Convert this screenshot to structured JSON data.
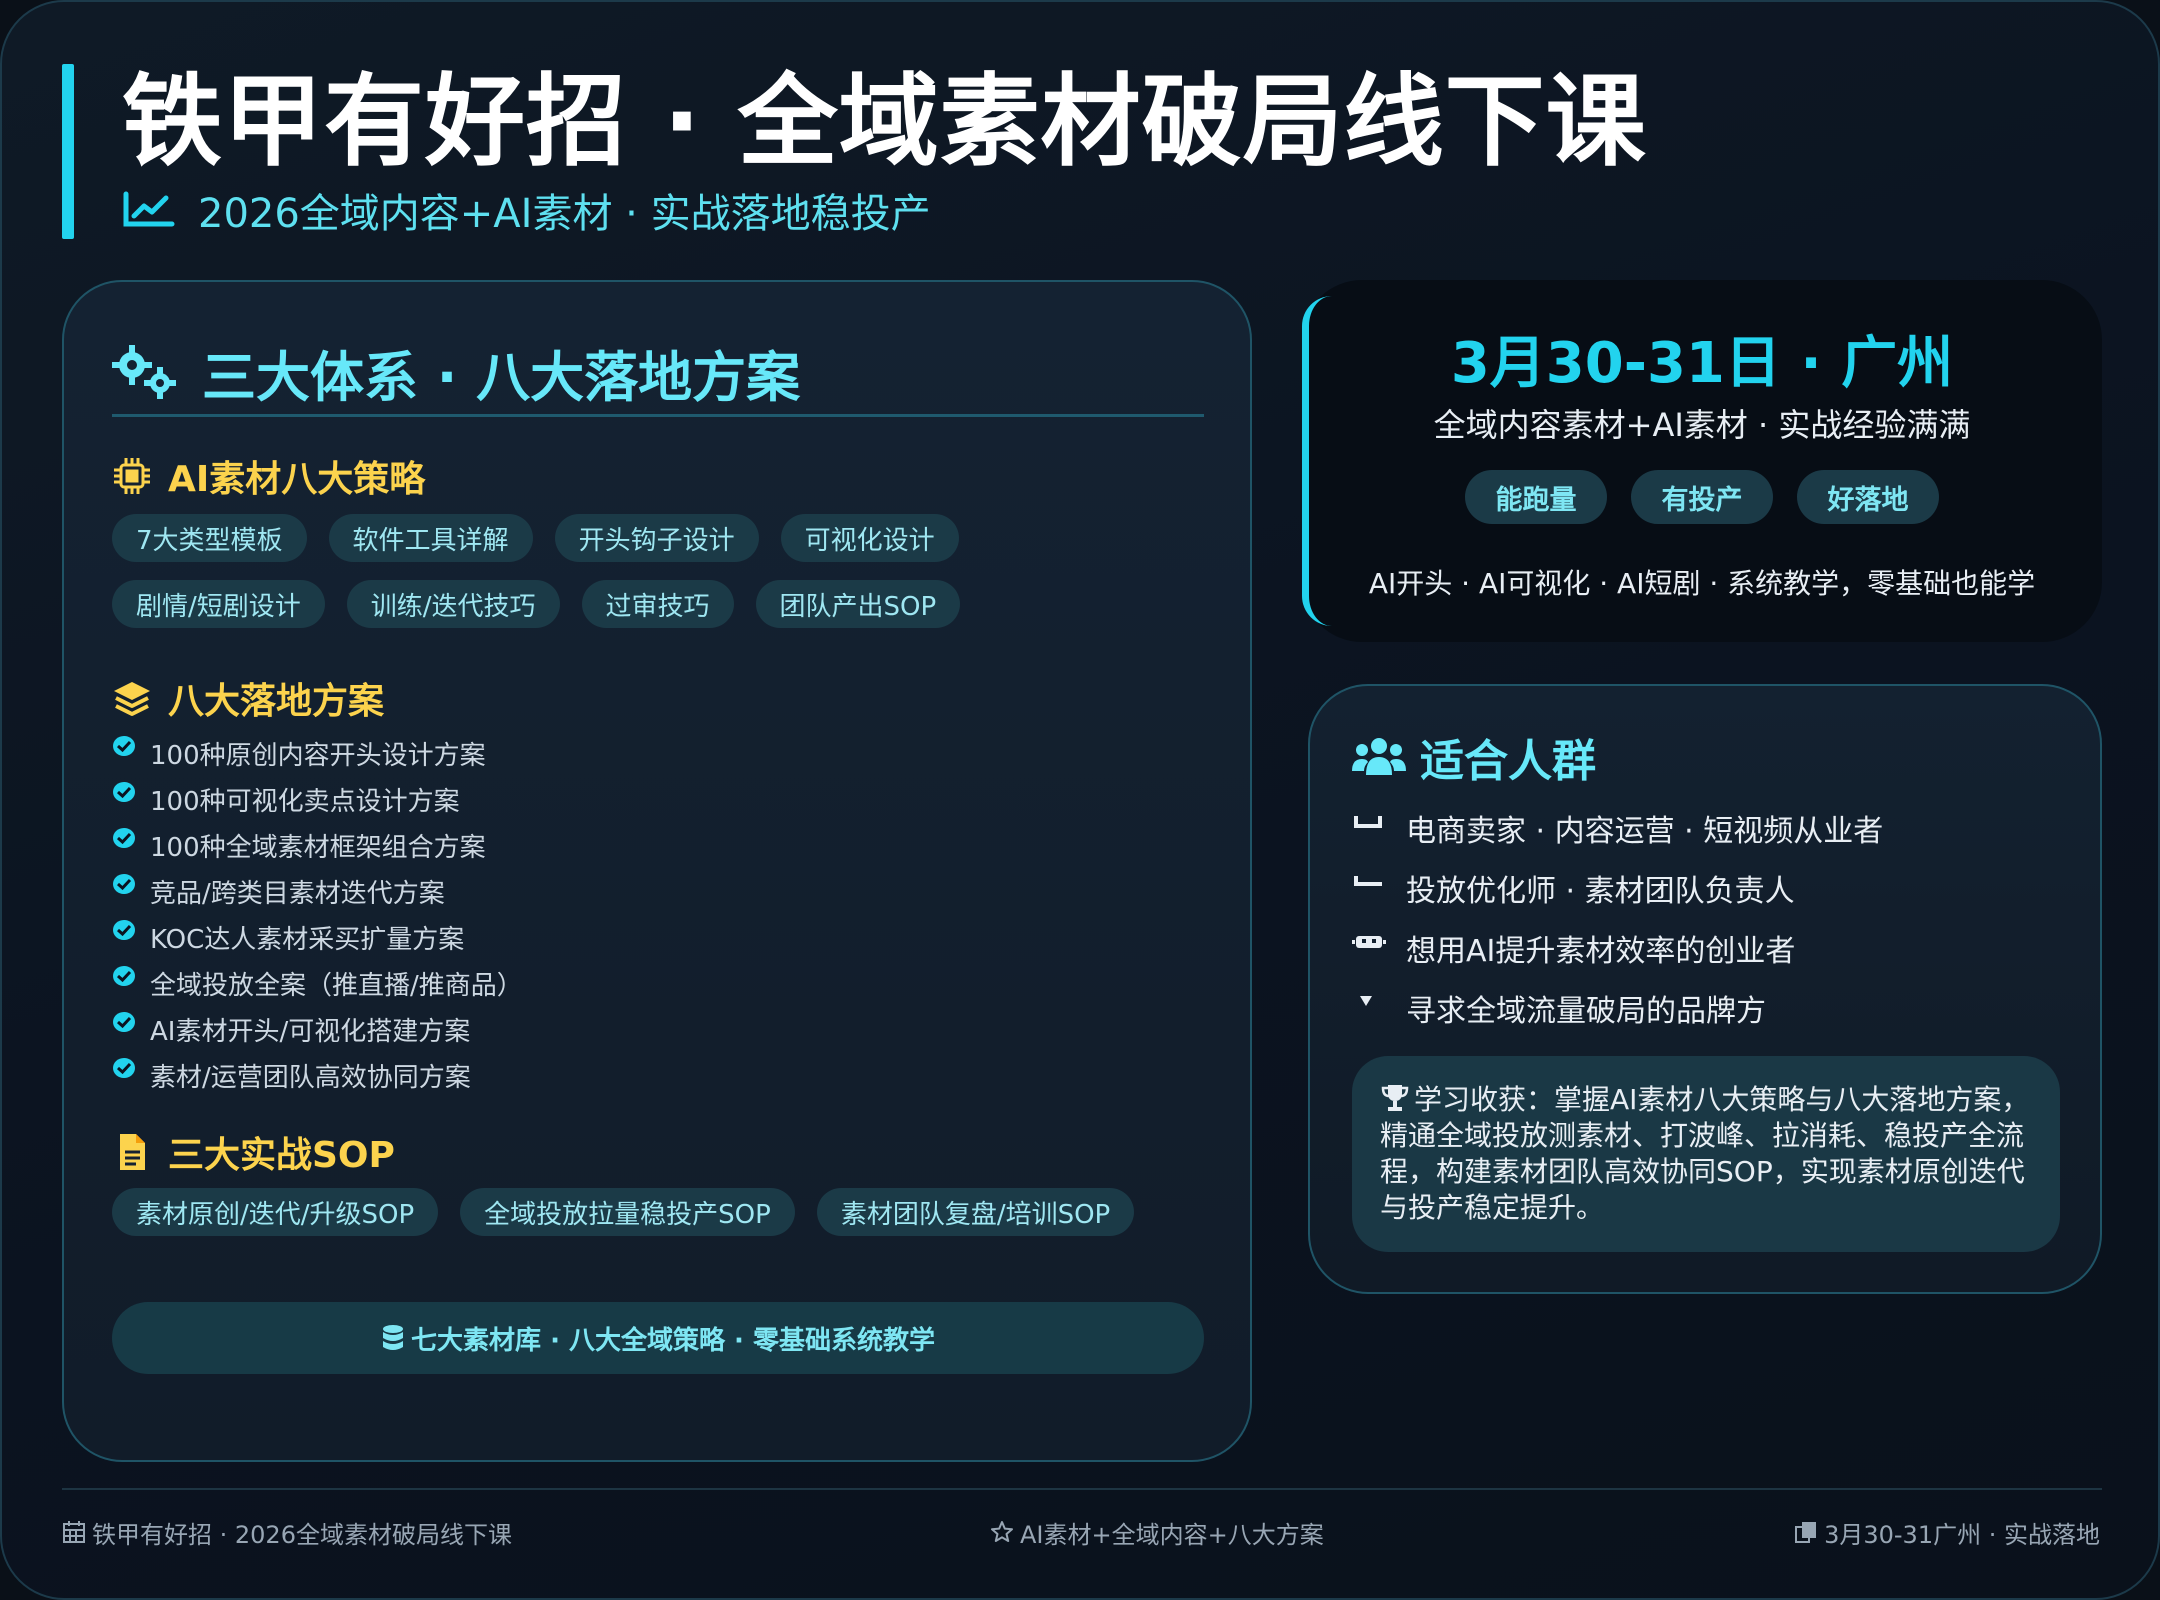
{
  "header": {
    "title": "铁甲有好招 · 全域素材破局线下课",
    "subtitle": "2026全域内容+AI素材 · 实战落地稳投产"
  },
  "left_panel": {
    "title": "三大体系 · 八大落地方案",
    "strategies": {
      "title": "AI素材八大策略",
      "chips": [
        "7大类型模板",
        "软件工具详解",
        "开头钩子设计",
        "可视化设计",
        "剧情/短剧设计",
        "训练/迭代技巧",
        "过审技巧",
        "团队产出SOP"
      ]
    },
    "plans": {
      "title": "八大落地方案",
      "items": [
        "100种原创内容开头设计方案",
        "100种可视化卖点设计方案",
        "100种全域素材框架组合方案",
        "竞品/跨类目素材迭代方案",
        "KOC达人素材采买扩量方案",
        "全域投放全案（推直播/推商品）",
        "AI素材开头/可视化搭建方案",
        "素材/运营团队高效协同方案"
      ]
    },
    "sops": {
      "title": "三大实战SOP",
      "chips": [
        "素材原创/迭代/升级SOP",
        "全域投放拉量稳投产SOP",
        "素材团队复盘/培训SOP"
      ]
    },
    "banner": "七大素材库 · 八大全域策略 · 零基础系统教学"
  },
  "event": {
    "date": "3月30-31日 · 广州",
    "desc": "全域内容素材+AI素材 · 实战经验满满",
    "badges": [
      "能跑量",
      "有投产",
      "好落地"
    ],
    "foot": "AI开头 · AI可视化 · AI短剧 · 系统教学，零基础也能学"
  },
  "audience": {
    "title": "适合人群",
    "items": [
      {
        "icon": "store-icon",
        "text": "电商卖家 · 内容运营 · 短视频从业者"
      },
      {
        "icon": "chart-line-icon",
        "text": "投放优化师 · 素材团队负责人"
      },
      {
        "icon": "robot-icon",
        "text": "想用AI提升素材效率的创业者"
      },
      {
        "icon": "rocket-icon",
        "text": "寻求全域流量破局的品牌方"
      }
    ],
    "gain": "学习收获：掌握AI素材八大策略与八大落地方案，精通全域投放测素材、打波峰、拉消耗、稳投产全流程，构建素材团队高效协同SOP，实现素材原创迭代与投产稳定提升。"
  },
  "footer": {
    "left": "铁甲有好招 · 2026全域素材破局线下课",
    "center": "AI素材+全域内容+八大方案",
    "right": "3月30-31广州 · 实战落地"
  },
  "colors": {
    "accent": "#22d3ee",
    "highlight": "#fcd34d",
    "chip_bg": "#1b3a47",
    "background": "#0a1018"
  }
}
